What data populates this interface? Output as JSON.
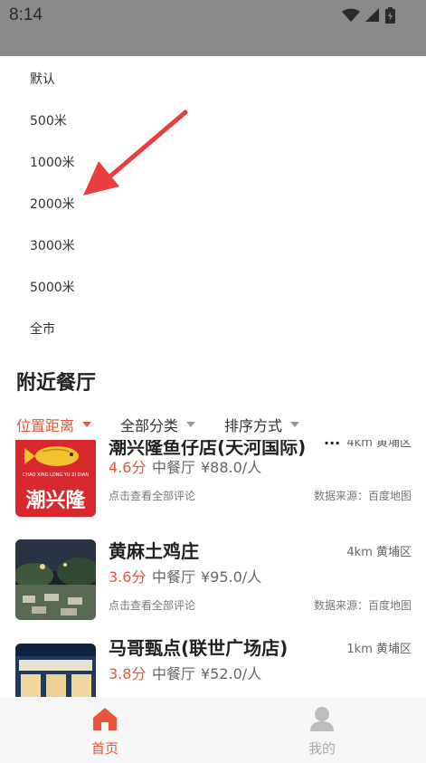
{
  "status_bar": {
    "time": "8:14",
    "icons": [
      "wifi-icon",
      "signal-icon",
      "battery-icon"
    ]
  },
  "dropdown": {
    "options": [
      "默认",
      "500米",
      "1000米",
      "2000米",
      "3000米",
      "5000米",
      "全市"
    ]
  },
  "section": {
    "title": "附近餐厅"
  },
  "filters": [
    {
      "label": "位置距离",
      "active": true
    },
    {
      "label": "全部分类",
      "active": false
    },
    {
      "label": "排序方式",
      "active": false
    }
  ],
  "restaurants": [
    {
      "name": "潮兴隆鱼仔店(天河国际)",
      "distance": "4km 黄埔区",
      "rating": "4.6分",
      "category": "中餐厅",
      "price": "¥88.0/人",
      "review_link": "点击查看全部评论",
      "source": "数据来源：百度地图",
      "more": "...",
      "logo_text": "潮兴隆",
      "logo_subtext": "CHAO XING LONG YU ZI DIAN"
    },
    {
      "name": "黄麻土鸡庄",
      "distance": "4km 黄埔区",
      "rating": "3.6分",
      "category": "中餐厅",
      "price": "¥95.0/人",
      "review_link": "点击查看全部评论",
      "source": "数据来源：百度地图"
    },
    {
      "name": "马哥甄点(联世广场店)",
      "distance": "1km 黄埔区",
      "rating": "3.8分",
      "category": "中餐厅",
      "price": "¥52.0/人"
    }
  ],
  "tabs": [
    {
      "label": "首页",
      "icon": "home-icon",
      "active": true
    },
    {
      "label": "我的",
      "icon": "user-icon",
      "active": false
    }
  ],
  "colors": {
    "accent": "#e8563a",
    "status_bar": "#8a8a8a",
    "logo_red": "#d9272e",
    "arrow": "#e83e3e"
  }
}
